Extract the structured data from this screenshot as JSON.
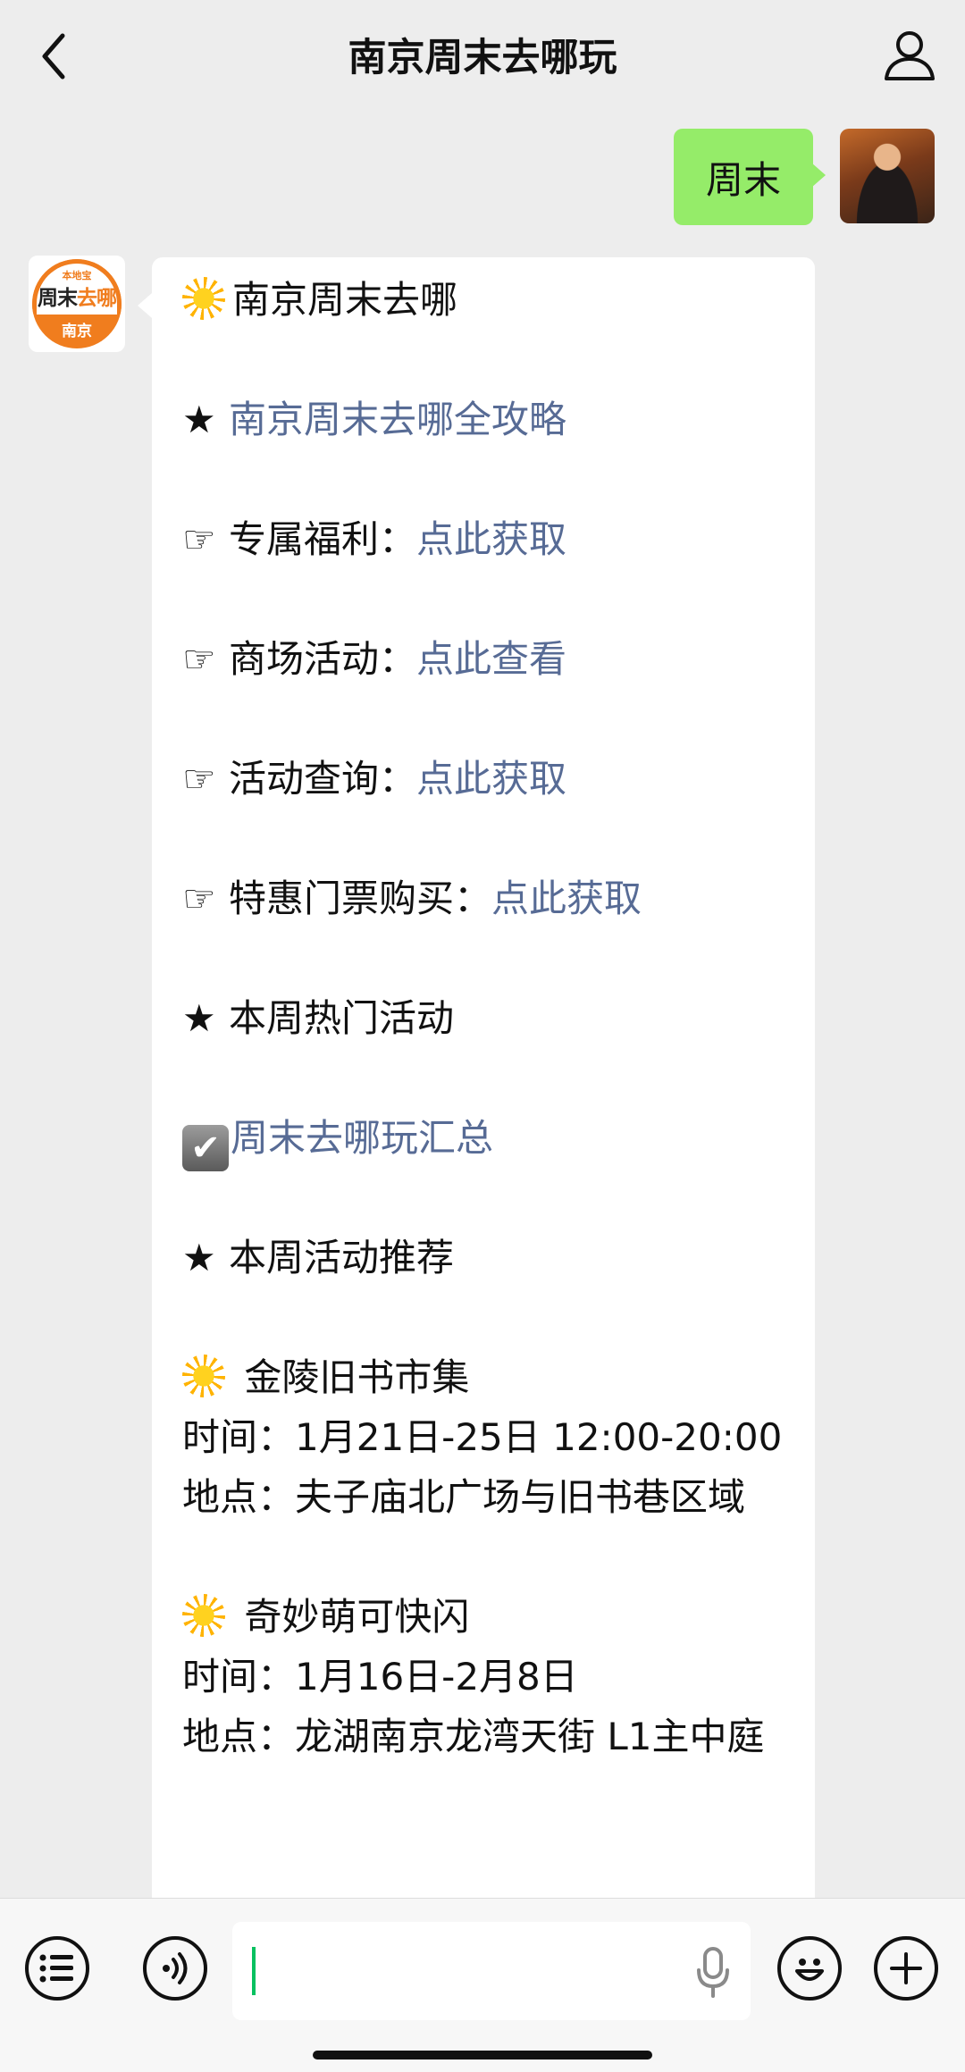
{
  "header": {
    "title": "南京周末去哪玩"
  },
  "user_message": {
    "text": "周末"
  },
  "bot_logo": {
    "small": "本地宝",
    "main_a": "周末",
    "main_b": "去哪",
    "city": "南京"
  },
  "bot_message": {
    "headline": "南京周末去哪",
    "guide_link": "南京周末去哪全攻略",
    "items": [
      {
        "label": "专属福利：",
        "link": "点此获取"
      },
      {
        "label": "商场活动：",
        "link": "点此查看"
      },
      {
        "label": "活动查询：",
        "link": "点此获取"
      },
      {
        "label": "特惠门票购买：",
        "link": "点此获取"
      }
    ],
    "hot_title": "本周热门活动",
    "summary_link": "周末去哪玩汇总",
    "rec_title": "本周活动推荐",
    "events": [
      {
        "name": "金陵旧书市集",
        "time": "时间：1月21日-25日 12:00-20:00",
        "place": "地点：夫子庙北广场与旧书巷区域"
      },
      {
        "name": "奇妙萌可快闪",
        "time": "时间：1月16日-2月8日",
        "place": "地点：龙湖南京龙湾天街 L1主中庭"
      }
    ]
  },
  "icons": {
    "back": "chevron-left-icon",
    "profile": "person-icon",
    "star": "★",
    "hand": "☞",
    "check": "✔",
    "sun": "sun-icon",
    "menu": "list-icon",
    "voice": "voice-icon",
    "mic": "mic-icon",
    "emoji": "smiley-icon",
    "plus": "plus-icon"
  },
  "colors": {
    "link": "#576b95",
    "my_bubble": "#95ec69",
    "background": "#ededed",
    "logo_orange": "#f07d1e"
  }
}
